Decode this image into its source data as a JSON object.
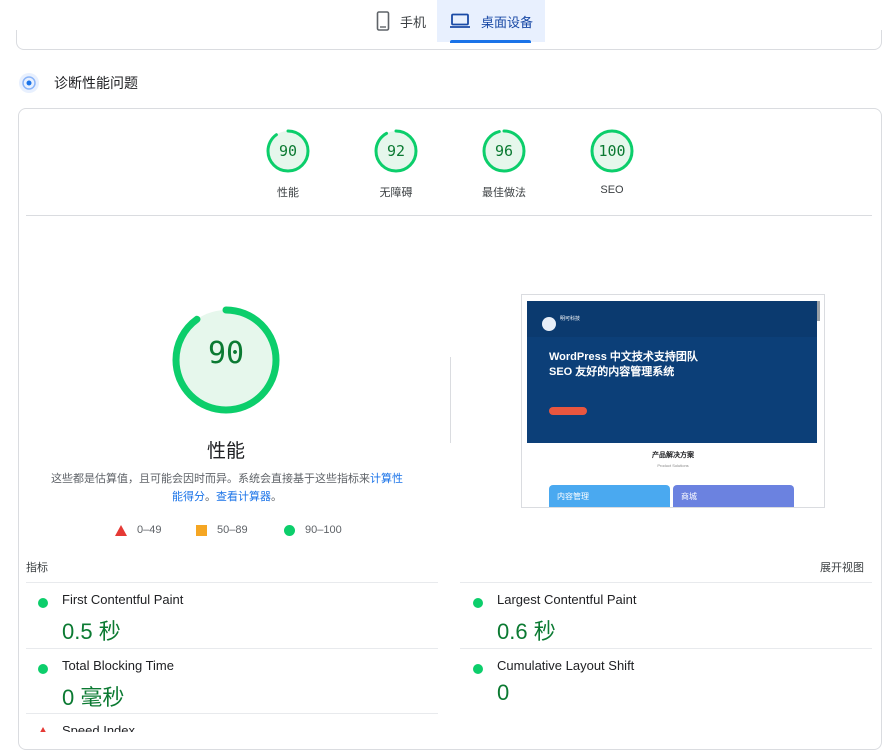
{
  "tabs": [
    {
      "label": "手机",
      "icon": "mobile-icon"
    },
    {
      "label": "桌面设备",
      "icon": "laptop-icon",
      "active": true
    }
  ],
  "section": {
    "title": "诊断性能问题"
  },
  "category_scores": [
    {
      "score": "90",
      "label": "性能"
    },
    {
      "score": "92",
      "label": "无障碍"
    },
    {
      "score": "96",
      "label": "最佳做法"
    },
    {
      "score": "100",
      "label": "SEO"
    }
  ],
  "main_score": {
    "score": "90",
    "label": "性能"
  },
  "description": {
    "text": "这些都是估算值，且可能会因时而异。系统会直接基于这些指标来",
    "link1": "计算性能得分",
    "sep": "。",
    "link2": "查看计算器",
    "end": "。"
  },
  "legend": [
    {
      "range": "0–49",
      "shape": "triangle",
      "color": "#e53935"
    },
    {
      "range": "50–89",
      "shape": "square",
      "color": "#f5a623"
    },
    {
      "range": "90–100",
      "shape": "circle",
      "color": "#0cce6b"
    }
  ],
  "preview": {
    "brand": "明可科技",
    "headline1": "WordPress 中文技术支持团队",
    "headline2": "SEO 友好的内容管理系统",
    "section_title": "产品解决方案",
    "section_sub": "Product Solutions",
    "box1": "内容管理",
    "box2": "商城"
  },
  "metrics": {
    "heading": "指标",
    "expand": "展开视图",
    "items": [
      {
        "name": "First Contentful Paint",
        "value": "0.5 秒"
      },
      {
        "name": "Largest Contentful Paint",
        "value": "0.6 秒"
      },
      {
        "name": "Total Blocking Time",
        "value": "0 毫秒"
      },
      {
        "name": "Cumulative Layout Shift",
        "value": "0"
      },
      {
        "name": "Speed Index",
        "value": ""
      }
    ]
  },
  "colors": {
    "good": "#0cce6b",
    "good_text": "#0b7a32",
    "accent": "#1a73e8"
  }
}
